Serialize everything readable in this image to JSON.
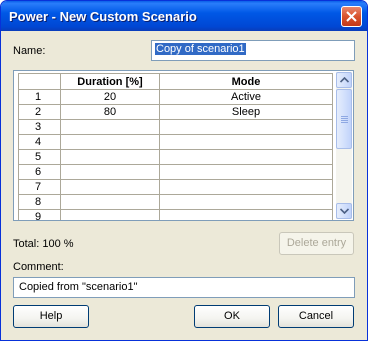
{
  "window": {
    "title": "Power - New Custom Scenario"
  },
  "name": {
    "label": "Name:",
    "value": "Copy of scenario1"
  },
  "grid": {
    "columns": [
      "Duration [%]",
      "Mode"
    ],
    "rows": [
      {
        "num": "1",
        "duration": "20",
        "mode": "Active"
      },
      {
        "num": "2",
        "duration": "80",
        "mode": "Sleep"
      },
      {
        "num": "3",
        "duration": "",
        "mode": ""
      },
      {
        "num": "4",
        "duration": "",
        "mode": ""
      },
      {
        "num": "5",
        "duration": "",
        "mode": ""
      },
      {
        "num": "6",
        "duration": "",
        "mode": ""
      },
      {
        "num": "7",
        "duration": "",
        "mode": ""
      },
      {
        "num": "8",
        "duration": "",
        "mode": ""
      },
      {
        "num": "9",
        "duration": "",
        "mode": ""
      }
    ]
  },
  "total": {
    "text": "Total: 100 %"
  },
  "buttons": {
    "delete": "Delete entry",
    "help": "Help",
    "ok": "OK",
    "cancel": "Cancel"
  },
  "comment": {
    "label": "Comment:",
    "value": "Copied from \"scenario1\""
  },
  "icons": {
    "close": "close-icon",
    "scroll_up": "arrow-up-icon",
    "scroll_down": "arrow-down-icon"
  },
  "colors": {
    "titlebar": "#0058e6",
    "dialog_bg": "#ece9d8",
    "selection": "#316ac5"
  }
}
